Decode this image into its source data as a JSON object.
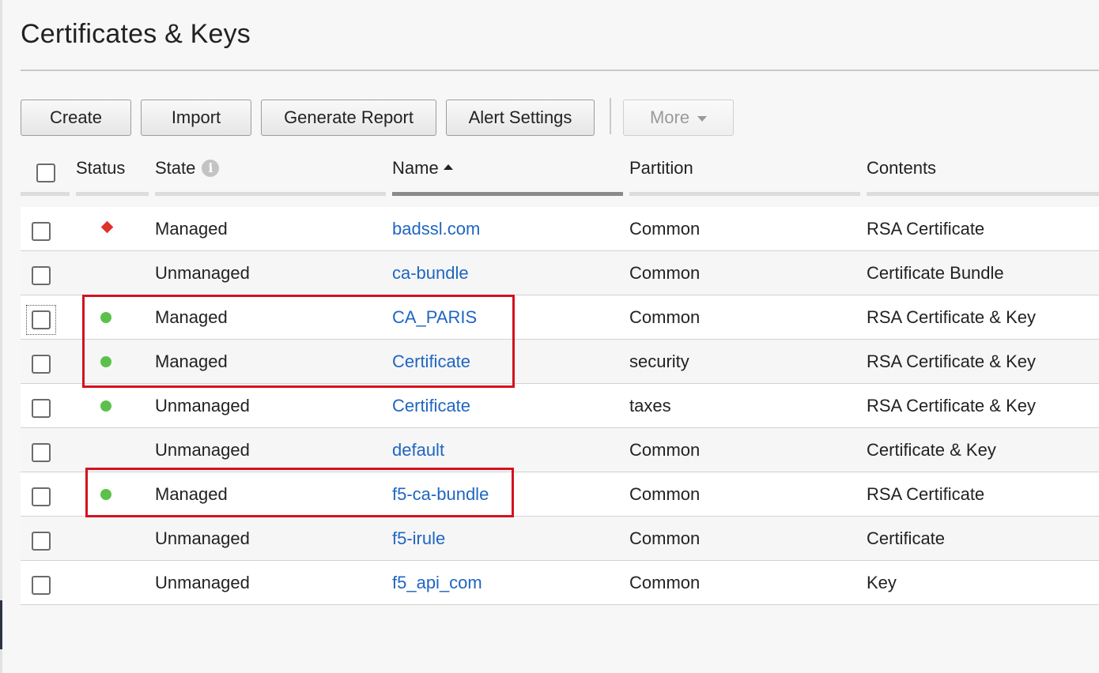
{
  "page": {
    "title": "Certificates & Keys"
  },
  "toolbar": {
    "create": "Create",
    "import": "Import",
    "generate_report": "Generate Report",
    "alert_settings": "Alert Settings",
    "more": "More"
  },
  "table": {
    "columns": {
      "status": "Status",
      "state": "State",
      "name": "Name",
      "partition": "Partition",
      "contents": "Contents"
    },
    "sorted_by": "Name",
    "sort_direction": "ascending",
    "rows": [
      {
        "status": "error",
        "state": "Managed",
        "name": "badssl.com",
        "partition": "Common",
        "contents": "RSA Certificate"
      },
      {
        "status": "none",
        "state": "Unmanaged",
        "name": "ca-bundle",
        "partition": "Common",
        "contents": "Certificate Bundle"
      },
      {
        "status": "ok",
        "state": "Managed",
        "name": "CA_PARIS",
        "partition": "Common",
        "contents": "RSA Certificate & Key"
      },
      {
        "status": "ok",
        "state": "Managed",
        "name": "Certificate",
        "partition": "security",
        "contents": "RSA Certificate & Key"
      },
      {
        "status": "ok",
        "state": "Unmanaged",
        "name": "Certificate",
        "partition": "taxes",
        "contents": "RSA Certificate & Key"
      },
      {
        "status": "none",
        "state": "Unmanaged",
        "name": "default",
        "partition": "Common",
        "contents": "Certificate & Key"
      },
      {
        "status": "ok",
        "state": "Managed",
        "name": "f5-ca-bundle",
        "partition": "Common",
        "contents": "RSA Certificate"
      },
      {
        "status": "none",
        "state": "Unmanaged",
        "name": "f5-irule",
        "partition": "Common",
        "contents": "Certificate"
      },
      {
        "status": "none",
        "state": "Unmanaged",
        "name": "f5_api_com",
        "partition": "Common",
        "contents": "Key"
      }
    ]
  },
  "icons": {
    "state_info": "info-icon",
    "sort_indicator": "sort-ascending-icon",
    "more_dropdown": "chevron-down-icon",
    "status_ok": "green-dot-icon",
    "status_error": "red-diamond-icon"
  },
  "colors": {
    "link": "#1f66c1",
    "status_ok": "#5cc14a",
    "status_error": "#e0312b",
    "highlight_box": "#d3121f"
  }
}
